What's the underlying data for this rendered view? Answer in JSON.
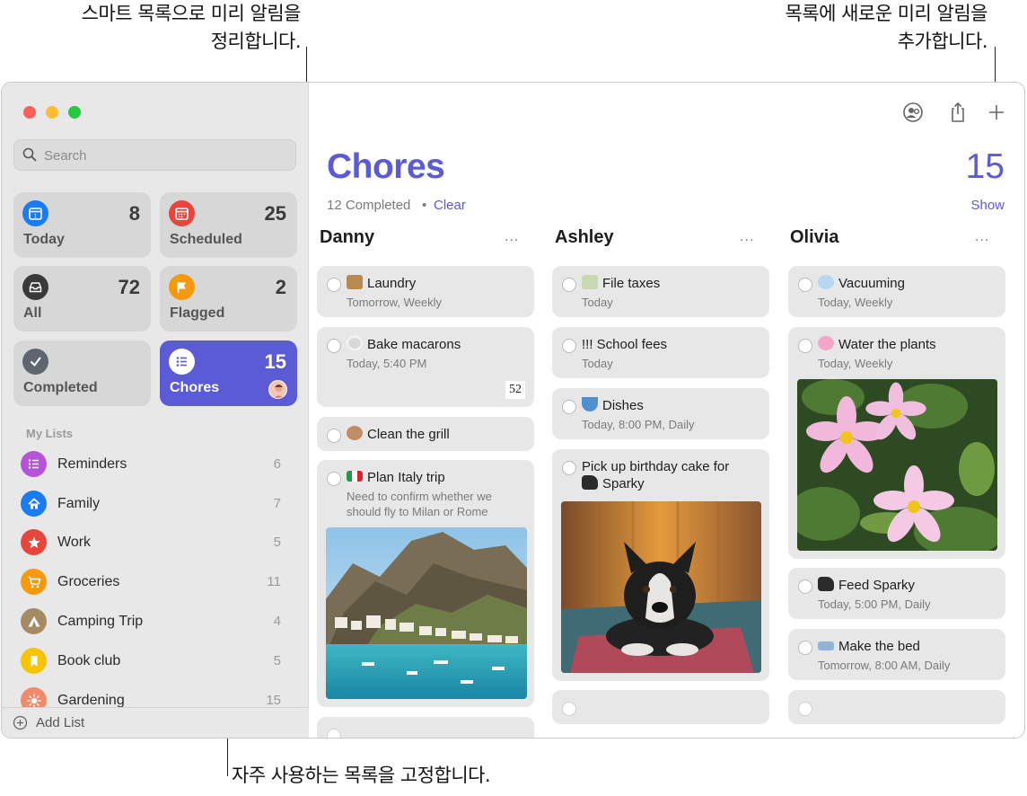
{
  "callouts": {
    "top_left_line1": "스마트 목록으로 미리 알림을",
    "top_left_line2": "정리합니다.",
    "top_right_line1": "목록에 새로운 미리 알림을",
    "top_right_line2": "추가합니다.",
    "bottom": "자주 사용하는 목록을 고정합니다."
  },
  "sidebar": {
    "search_placeholder": "Search",
    "smart_lists": [
      {
        "label": "Today",
        "count": "8",
        "color": "#1a7cf5",
        "icon": "calendar-today-icon"
      },
      {
        "label": "Scheduled",
        "count": "25",
        "color": "#e8453c",
        "icon": "calendar-grid-icon"
      },
      {
        "label": "All",
        "count": "72",
        "color": "#3a3a3a",
        "icon": "tray-icon"
      },
      {
        "label": "Flagged",
        "count": "2",
        "color": "#f59a0c",
        "icon": "flag-icon"
      },
      {
        "label": "Completed",
        "count": "",
        "color": "#5e6670",
        "icon": "checkmark-icon"
      },
      {
        "label": "Chores",
        "count": "15",
        "color": "#5b5bd6",
        "icon": "list-bullet-icon"
      }
    ],
    "my_lists_header": "My Lists",
    "lists": [
      {
        "name": "Reminders",
        "count": "6",
        "color": "#b554d8",
        "icon": "list-bullet-icon"
      },
      {
        "name": "Family",
        "count": "7",
        "color": "#1a7cf5",
        "icon": "house-icon"
      },
      {
        "name": "Work",
        "count": "5",
        "color": "#e8453c",
        "icon": "star-icon"
      },
      {
        "name": "Groceries",
        "count": "11",
        "color": "#f59a0c",
        "icon": "cart-icon"
      },
      {
        "name": "Camping Trip",
        "count": "4",
        "color": "#a58b63",
        "icon": "tent-icon"
      },
      {
        "name": "Book club",
        "count": "5",
        "color": "#f6c400",
        "icon": "bookmark-icon"
      },
      {
        "name": "Gardening",
        "count": "15",
        "color": "#f08a6a",
        "icon": "sun-icon"
      }
    ],
    "add_list": "Add List"
  },
  "main": {
    "title": "Chores",
    "count": "15",
    "completed": "12 Completed",
    "separator": "•",
    "clear": "Clear",
    "show": "Show",
    "more": "...",
    "columns": [
      {
        "name": "Danny"
      },
      {
        "name": "Ashley"
      },
      {
        "name": "Olivia"
      }
    ],
    "cards": {
      "laundry": {
        "title": "Laundry",
        "sub": "Tomorrow, Weekly"
      },
      "macarons": {
        "title": "Bake macarons",
        "sub": "Today, 5:40 PM",
        "badge": "52"
      },
      "grill": {
        "title": "Clean the grill"
      },
      "italy": {
        "title": "Plan Italy trip",
        "sub1": "Need to confirm whether we",
        "sub2": "should fly to Milan or Rome"
      },
      "taxes": {
        "title": "File taxes",
        "sub": "Today"
      },
      "school": {
        "title": "!!! School fees",
        "sub": "Today"
      },
      "dishes": {
        "title": "Dishes",
        "sub": "Today, 8:00 PM, Daily"
      },
      "cake": {
        "title1": "Pick up birthday cake for",
        "title2": "Sparky"
      },
      "vacuum": {
        "title": "Vacuuming",
        "sub": "Today, Weekly"
      },
      "plants": {
        "title": "Water the plants",
        "sub": "Today, Weekly"
      },
      "feed": {
        "title": "Feed Sparky",
        "sub": "Today, 5:00 PM, Daily"
      },
      "bed": {
        "title": "Make the bed",
        "sub": "Tomorrow, 8:00 AM, Daily"
      }
    }
  }
}
